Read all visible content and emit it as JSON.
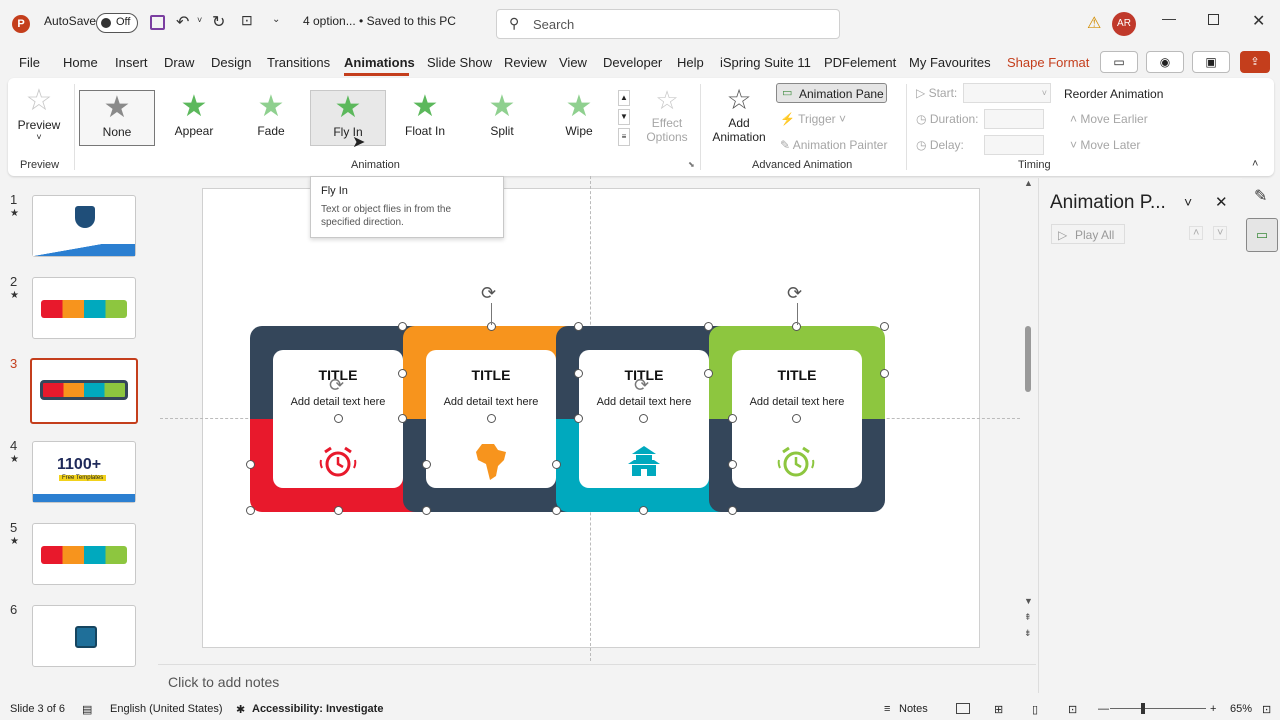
{
  "titlebar": {
    "autosave_label": "AutoSave",
    "autosave_state": "Off",
    "doc_title": "4 option... • Saved to this PC",
    "search_placeholder": "Search",
    "user_initials": "AR"
  },
  "menu": [
    "File",
    "Home",
    "Insert",
    "Draw",
    "Design",
    "Transitions",
    "Animations",
    "Slide Show",
    "Review",
    "View",
    "Developer",
    "Help",
    "iSpring Suite 11",
    "PDFelement",
    "My Favourites",
    "Shape Format"
  ],
  "ribbon": {
    "preview_label": "Preview",
    "preview_group": "Preview",
    "gallery": [
      "None",
      "Appear",
      "Fade",
      "Fly In",
      "Float In",
      "Split",
      "Wipe"
    ],
    "effect_options_1": "Effect",
    "effect_options_2": "Options",
    "animation_group": "Animation",
    "add_animation_1": "Add",
    "add_animation_2": "Animation",
    "animation_pane_btn": "Animation Pane",
    "trigger": "Trigger",
    "animation_painter": "Animation Painter",
    "advanced_group": "Advanced Animation",
    "start": "Start:",
    "duration": "Duration:",
    "delay": "Delay:",
    "reorder": "Reorder Animation",
    "move_earlier": "Move Earlier",
    "move_later": "Move Later",
    "timing_group": "Timing"
  },
  "tooltip": {
    "title": "Fly In",
    "body_1": "Text or object flies in from the",
    "body_2": "specified direction."
  },
  "slides": [
    "1",
    "2",
    "3",
    "4",
    "5",
    "6"
  ],
  "slide_content": {
    "cards": [
      {
        "title": "TITLE",
        "detail": "Add detail text here",
        "color": "#e8192c",
        "frame_color": "#34465a"
      },
      {
        "title": "TITLE",
        "detail": "Add detail text here",
        "color": "#f7941d",
        "frame_color": "#34465a"
      },
      {
        "title": "TITLE",
        "detail": "Add detail text here",
        "color": "#00a9be",
        "frame_color": "#34465a"
      },
      {
        "title": "TITLE",
        "detail": "Add detail text here",
        "color": "#8dc63f",
        "frame_color": "#34465a"
      }
    ],
    "thumb4_text": "1100+",
    "thumb4_sub": "Free Templates"
  },
  "notes_placeholder": "Click to add notes",
  "anim_pane": {
    "title": "Animation P...",
    "play_all": "Play All"
  },
  "status": {
    "slide_info": "Slide 3 of 6",
    "language": "English (United States)",
    "accessibility": "Accessibility: Investigate",
    "notes": "Notes",
    "zoom": "65%"
  }
}
